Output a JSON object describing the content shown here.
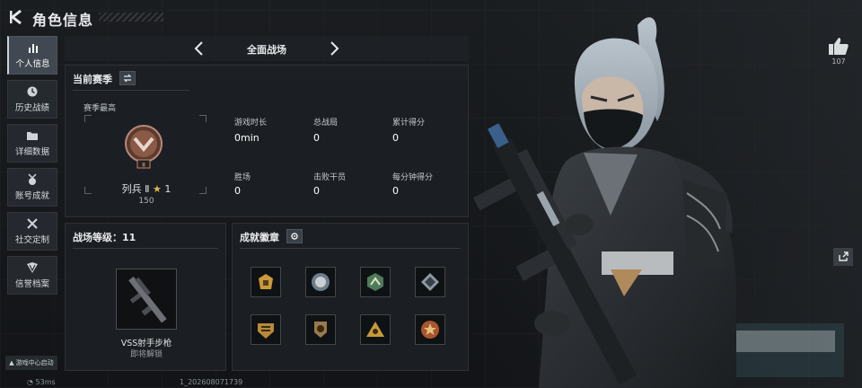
{
  "header": {
    "title": "角色信息"
  },
  "sidebar": {
    "items": [
      {
        "label": "个人信息",
        "icon": "bar-chart-icon",
        "active": true
      },
      {
        "label": "历史战绩",
        "icon": "clock-icon",
        "active": false
      },
      {
        "label": "详细数据",
        "icon": "folder-icon",
        "active": false
      },
      {
        "label": "账号成就",
        "icon": "medal-icon",
        "active": false
      },
      {
        "label": "社交定制",
        "icon": "tools-icon",
        "active": false
      },
      {
        "label": "信誉档案",
        "icon": "shield-icon",
        "active": false
      }
    ]
  },
  "battlefield": {
    "title": "全面战场"
  },
  "season": {
    "heading": "当前赛季",
    "best_label": "赛季最高",
    "rank_name": "列兵 Ⅱ",
    "rank_stars": "1",
    "rank_score": "150",
    "rank_badge_number": "II",
    "stats": [
      {
        "label": "游戏时长",
        "value": "0min"
      },
      {
        "label": "总战局",
        "value": "0"
      },
      {
        "label": "累计得分",
        "value": "0"
      },
      {
        "label": "胜场",
        "value": "0"
      },
      {
        "label": "击败干员",
        "value": "0"
      },
      {
        "label": "每分钟得分",
        "value": "0"
      }
    ]
  },
  "level": {
    "heading": "战场等级：11",
    "weapon_name": "VSS射手步枪",
    "weapon_status": "即将解锁"
  },
  "badges": {
    "heading": "成就徽章",
    "items": [
      "badge-1",
      "badge-2",
      "badge-3",
      "badge-4",
      "badge-5",
      "badge-6",
      "badge-7",
      "badge-8"
    ]
  },
  "bottom": {
    "game_center": "游戏中心启动",
    "ping": "53ms",
    "id_suffix": "1_202608071739"
  },
  "social": {
    "like_count": "107"
  },
  "colors": {
    "accent": "#c9d2da",
    "panel": "#1c2024",
    "gold": "#e0b64c",
    "bronze": "#8a5a44"
  }
}
